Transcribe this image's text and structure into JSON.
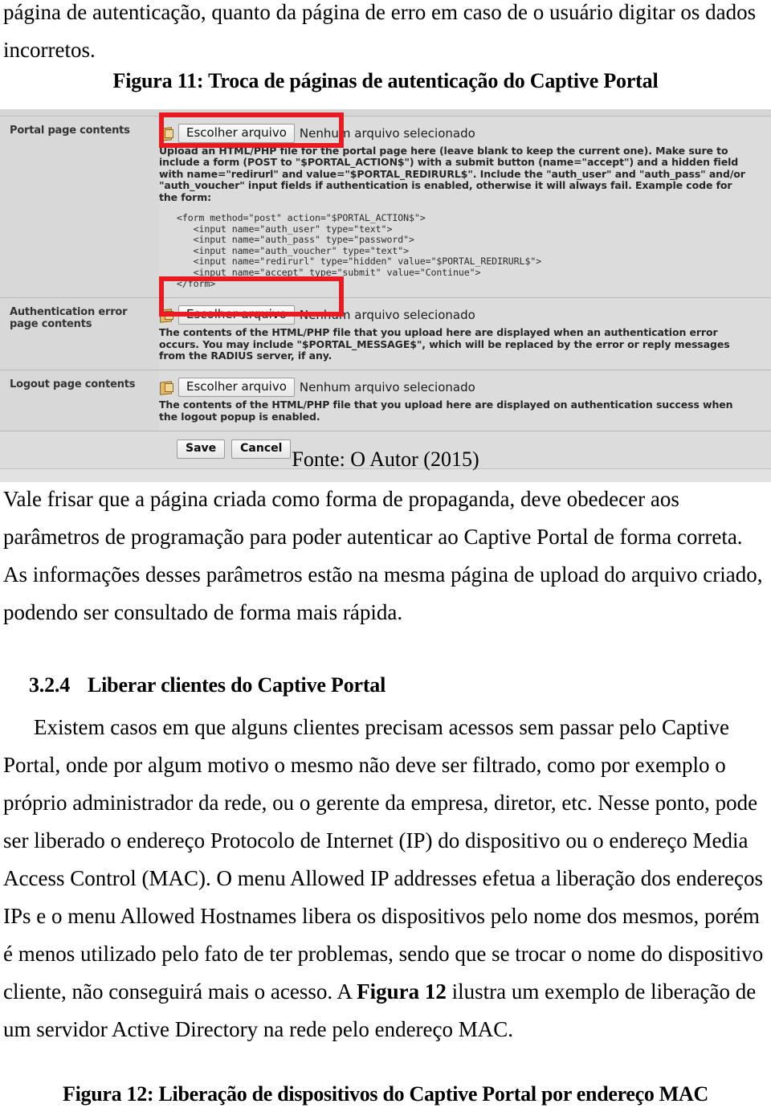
{
  "document": {
    "top_paragraph": "página de autenticação, quanto da página de erro em caso de o usuário digitar os dados incorretos.",
    "figure11_title": "Figura 11: Troca de páginas de autenticação do Captive Portal",
    "figure11_source": "Fonte: O Autor (2015)",
    "paragraph_after_figure": "Vale frisar que a página criada como forma de propaganda, deve obedecer aos parâmetros de programação para poder autenticar ao Captive Portal de forma correta. As informações desses parâmetros estão na mesma página de upload do arquivo criado, podendo ser consultado de forma mais rápida.",
    "section": {
      "number": "3.2.4",
      "title": "Liberar clientes do Captive Portal"
    },
    "section_paragraph_part1": "Existem casos em que alguns clientes precisam acessos sem passar pelo Captive Portal, onde por algum motivo o mesmo não deve ser filtrado, como por exemplo o próprio administrador da rede, ou o gerente da empresa, diretor, etc. Nesse ponto, pode ser liberado o endereço Protocolo de Internet (IP) do dispositivo ou o endereço Media Access Control (MAC).  O menu Allowed IP addresses efetua a liberação dos endereços IPs e o menu Allowed Hostnames libera os dispositivos pelo nome dos mesmos, porém é menos utilizado pelo fato de ter problemas, sendo que se trocar o nome do dispositivo cliente, não conseguirá mais o acesso. A ",
    "section_paragraph_bold": "Figura 12",
    "section_paragraph_part2": " ilustra um exemplo de liberação de um servidor Active Directory na rede pelo endereço MAC.",
    "figure12_caption": "Figura 12: Liberação de dispositivos do Captive Portal por endereço MAC",
    "lines": {
      "top": [
        "página de autenticação, quanto da página de erro em caso de o usuário digitar os dados",
        "incorretos."
      ],
      "after_figure": [
        "Vale frisar que a página criada como forma de propaganda, deve obedecer aos",
        "parâmetros de programação para poder autenticar ao Captive Portal de forma correta.",
        "As informações desses parâmetros estão na mesma página de upload do arquivo criado,",
        "podendo ser consultado de forma mais rápida."
      ],
      "section_body": [
        "Existem casos em que alguns clientes precisam acessos sem passar pelo Captive",
        "Portal, onde por algum motivo o mesmo não deve ser filtrado, como por exemplo o",
        "próprio administrador da rede, ou o gerente da empresa, diretor, etc. Nesse ponto, pode",
        "ser liberado o endereço Protocolo de Internet (IP) do dispositivo ou o endereço Media",
        "Access Control (MAC).  O menu Allowed IP addresses efetua a liberação dos endereços",
        "IPs e o menu Allowed Hostnames libera os dispositivos pelo nome dos mesmos, porém",
        "é menos utilizado pelo fato de ter problemas, sendo que se trocar o nome do dispositivo",
        "um servidor Active Directory na rede pelo endereço MAC."
      ],
      "section_last_a": "cliente, não conseguirá mais o acesso. A ",
      "section_last_bold": "Figura 12",
      "section_last_b": " ilustra um exemplo de liberação de"
    }
  },
  "figure11": {
    "rows": [
      {
        "label": "Portal page contents",
        "button_label": "Escolher arquivo",
        "file_status": "Nenhum arquivo selecionado",
        "help_text": "Upload an HTML/PHP file for the portal page here (leave blank to keep the current one). Make sure to include a form (POST to \"$PORTAL_ACTION$\") with a submit button (name=\"accept\") and a hidden field with name=\"redirurl\" and value=\"$PORTAL_REDIRURL$\". Include the \"auth_user\" and \"auth_pass\" and/or \"auth_voucher\" input fields if authentication is enabled, otherwise it will always fail. Example code for the form:",
        "code": "<form method=\"post\" action=\"$PORTAL_ACTION$\">\n   <input name=\"auth_user\" type=\"text\">\n   <input name=\"auth_pass\" type=\"password\">\n   <input name=\"auth_voucher\" type=\"text\">\n   <input name=\"redirurl\" type=\"hidden\" value=\"$PORTAL_REDIRURL$\">\n   <input name=\"accept\" type=\"submit\" value=\"Continue\">\n</form>"
      },
      {
        "label": "Authentication error page contents",
        "button_label": "Escolher arquivo",
        "file_status": "Nenhum arquivo selecionado",
        "help_text": "The contents of the HTML/PHP file that you upload here are displayed when an authentication error occurs. You may include \"$PORTAL_MESSAGE$\", which will be replaced by the error or reply messages from the RADIUS server, if any.",
        "code": ""
      },
      {
        "label": "Logout page contents",
        "button_label": "Escolher arquivo",
        "file_status": "Nenhum arquivo selecionado",
        "help_text": "The contents of the HTML/PHP file that you upload here are displayed on authentication success when the logout popup is enabled.",
        "code": ""
      }
    ],
    "save_label": "Save",
    "cancel_label": "Cancel",
    "annotation_color": "#e81b23"
  }
}
